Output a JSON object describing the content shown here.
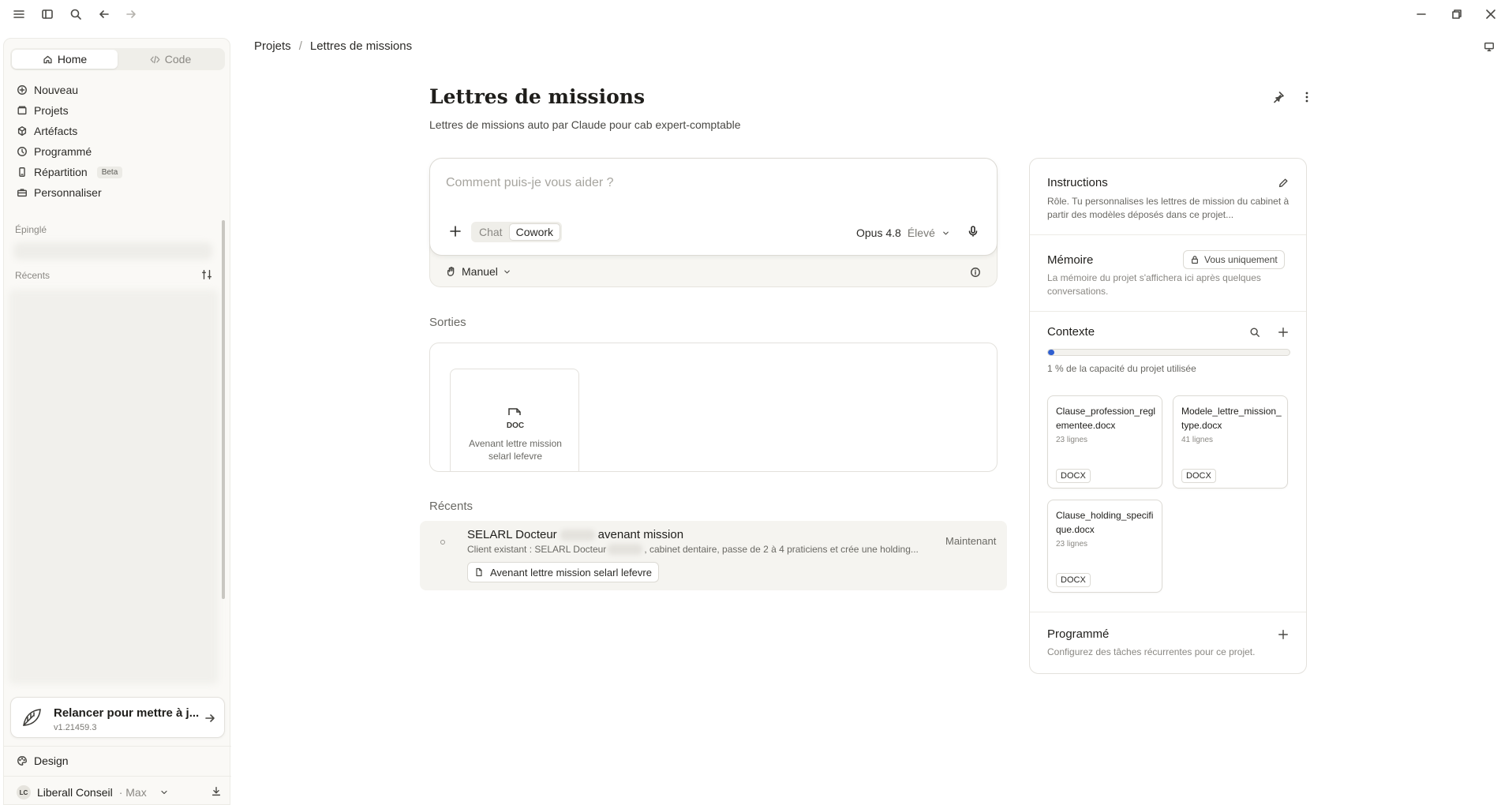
{
  "sidebar": {
    "tabs": [
      {
        "label": "Home"
      },
      {
        "label": "Code"
      }
    ],
    "nav": [
      {
        "label": "Nouveau",
        "icon": "plus-icon"
      },
      {
        "label": "Projets",
        "icon": "folder-icon"
      },
      {
        "label": "Artéfacts",
        "icon": "artifacts-icon"
      },
      {
        "label": "Programmé",
        "icon": "clock-icon"
      },
      {
        "label": "Répartition",
        "icon": "phone-icon",
        "badge": "Beta"
      },
      {
        "label": "Personnaliser",
        "icon": "briefcase-icon"
      }
    ],
    "pinned_label": "Épinglé",
    "recents_label": "Récents",
    "update": {
      "title": "Relancer pour mettre à j...",
      "version": "v1.21459.3"
    },
    "design_label": "Design",
    "user": {
      "initials": "LC",
      "name": "Liberall Conseil",
      "plan": "· Max"
    }
  },
  "breadcrumb": {
    "parent": "Projets",
    "separator": "/",
    "current": "Lettres de missions"
  },
  "project": {
    "title": "Lettres de missions",
    "subtitle": "Lettres de missions auto par Claude pour cab expert-comptable"
  },
  "composer": {
    "placeholder": "Comment puis-je vous aider ?",
    "modes": [
      {
        "label": "Chat",
        "active": false
      },
      {
        "label": "Cowork",
        "active": true
      }
    ],
    "model": "Opus 4.8",
    "effort": "Élevé",
    "permission": "Manuel"
  },
  "outputs": {
    "heading": "Sorties",
    "items": [
      {
        "type": "DOC",
        "name": "Avenant lettre mission selarl lefevre"
      }
    ]
  },
  "recents": {
    "heading": "Récents",
    "items": [
      {
        "title_start": "SELARL Docteur",
        "title_end": "avenant mission",
        "desc_start": "Client existant : SELARL Docteur",
        "desc_end": ", cabinet dentaire, passe de 2 à 4 praticiens et crée une holding...",
        "time": "Maintenant",
        "attachment": "Avenant lettre mission selarl lefevre"
      }
    ]
  },
  "panel": {
    "instructions": {
      "title": "Instructions",
      "text": "Rôle. Tu personnalises les lettres de mission du cabinet à partir des modèles déposés dans ce projet..."
    },
    "memory": {
      "title": "Mémoire",
      "badge": "Vous uniquement",
      "text": "La mémoire du projet s'affichera ici après quelques conversations."
    },
    "context": {
      "title": "Contexte",
      "capacity_text": "1 % de la capacité du projet utilisée",
      "capacity_fraction": 0.01,
      "files": [
        {
          "name": "Clause_profession_reglementee.docx",
          "lines": "23 lignes",
          "type": "DOCX"
        },
        {
          "name": "Modele_lettre_mission_type.docx",
          "lines": "41 lignes",
          "type": "DOCX"
        },
        {
          "name": "Clause_holding_specifique.docx",
          "lines": "23 lignes",
          "type": "DOCX"
        }
      ]
    },
    "scheduled": {
      "title": "Programmé",
      "text": "Configurez des tâches récurrentes pour ce projet."
    }
  },
  "colors": {
    "accent": "#2f5fd0",
    "background": "#ffffff",
    "sidebar": "#faf9f6"
  }
}
